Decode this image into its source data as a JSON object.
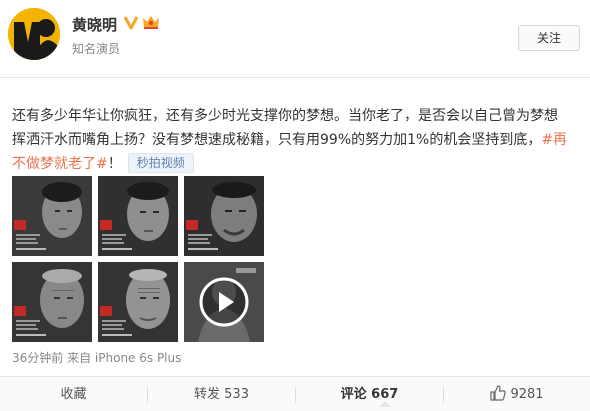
{
  "user": {
    "name": "黄晓明",
    "subtitle": "知名演员",
    "follow_label": "关注",
    "brand_color": "#f2b400",
    "verified_color": "#f5a623"
  },
  "post": {
    "line1": "还有多少年华让你疯狂，还有多少时光支撑你的梦想。当你老了，是否会以自己曾为梦想",
    "line2": "挥洒汗水而嘴角上扬？没有梦想速成秘籍，只有用99%的努力加1%的机会坚持到底，",
    "hashtag_part1": "#再",
    "hashtag_part2": "不做梦就老了#",
    "after_hashtag": "！",
    "video_tag": "秒拍视频",
    "hashtag_color": "#eb7350"
  },
  "images": [
    {
      "icon": "portrait-young-icon"
    },
    {
      "icon": "portrait-adult-icon"
    },
    {
      "icon": "portrait-middle-aged-icon"
    },
    {
      "icon": "portrait-older-icon"
    },
    {
      "icon": "portrait-elderly-icon"
    },
    {
      "icon": "video-play-icon"
    }
  ],
  "meta": {
    "time": "36分钟前",
    "source": "来自 iPhone 6s Plus"
  },
  "actions": {
    "favorite": "收藏",
    "repost": "转发 533",
    "comment": "评论 667",
    "likes": "9281"
  }
}
